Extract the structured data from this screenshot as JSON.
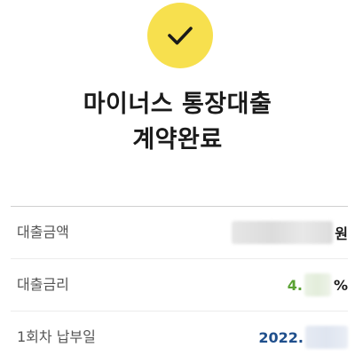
{
  "header": {
    "status_icon": "check-icon",
    "accent_color": "#f7e04e",
    "title_line1": "마이너스 통장대출",
    "title_line2": "계약완료"
  },
  "details": {
    "loan_amount": {
      "label": "대출금액",
      "value_suffix": "원"
    },
    "interest_rate": {
      "label": "대출금리",
      "value_prefix": "4.",
      "value_suffix": "%",
      "color": "#5aa233"
    },
    "first_payment": {
      "label": "1회차 납부일",
      "value_prefix": "2022.",
      "color": "#1f4f8c"
    }
  }
}
